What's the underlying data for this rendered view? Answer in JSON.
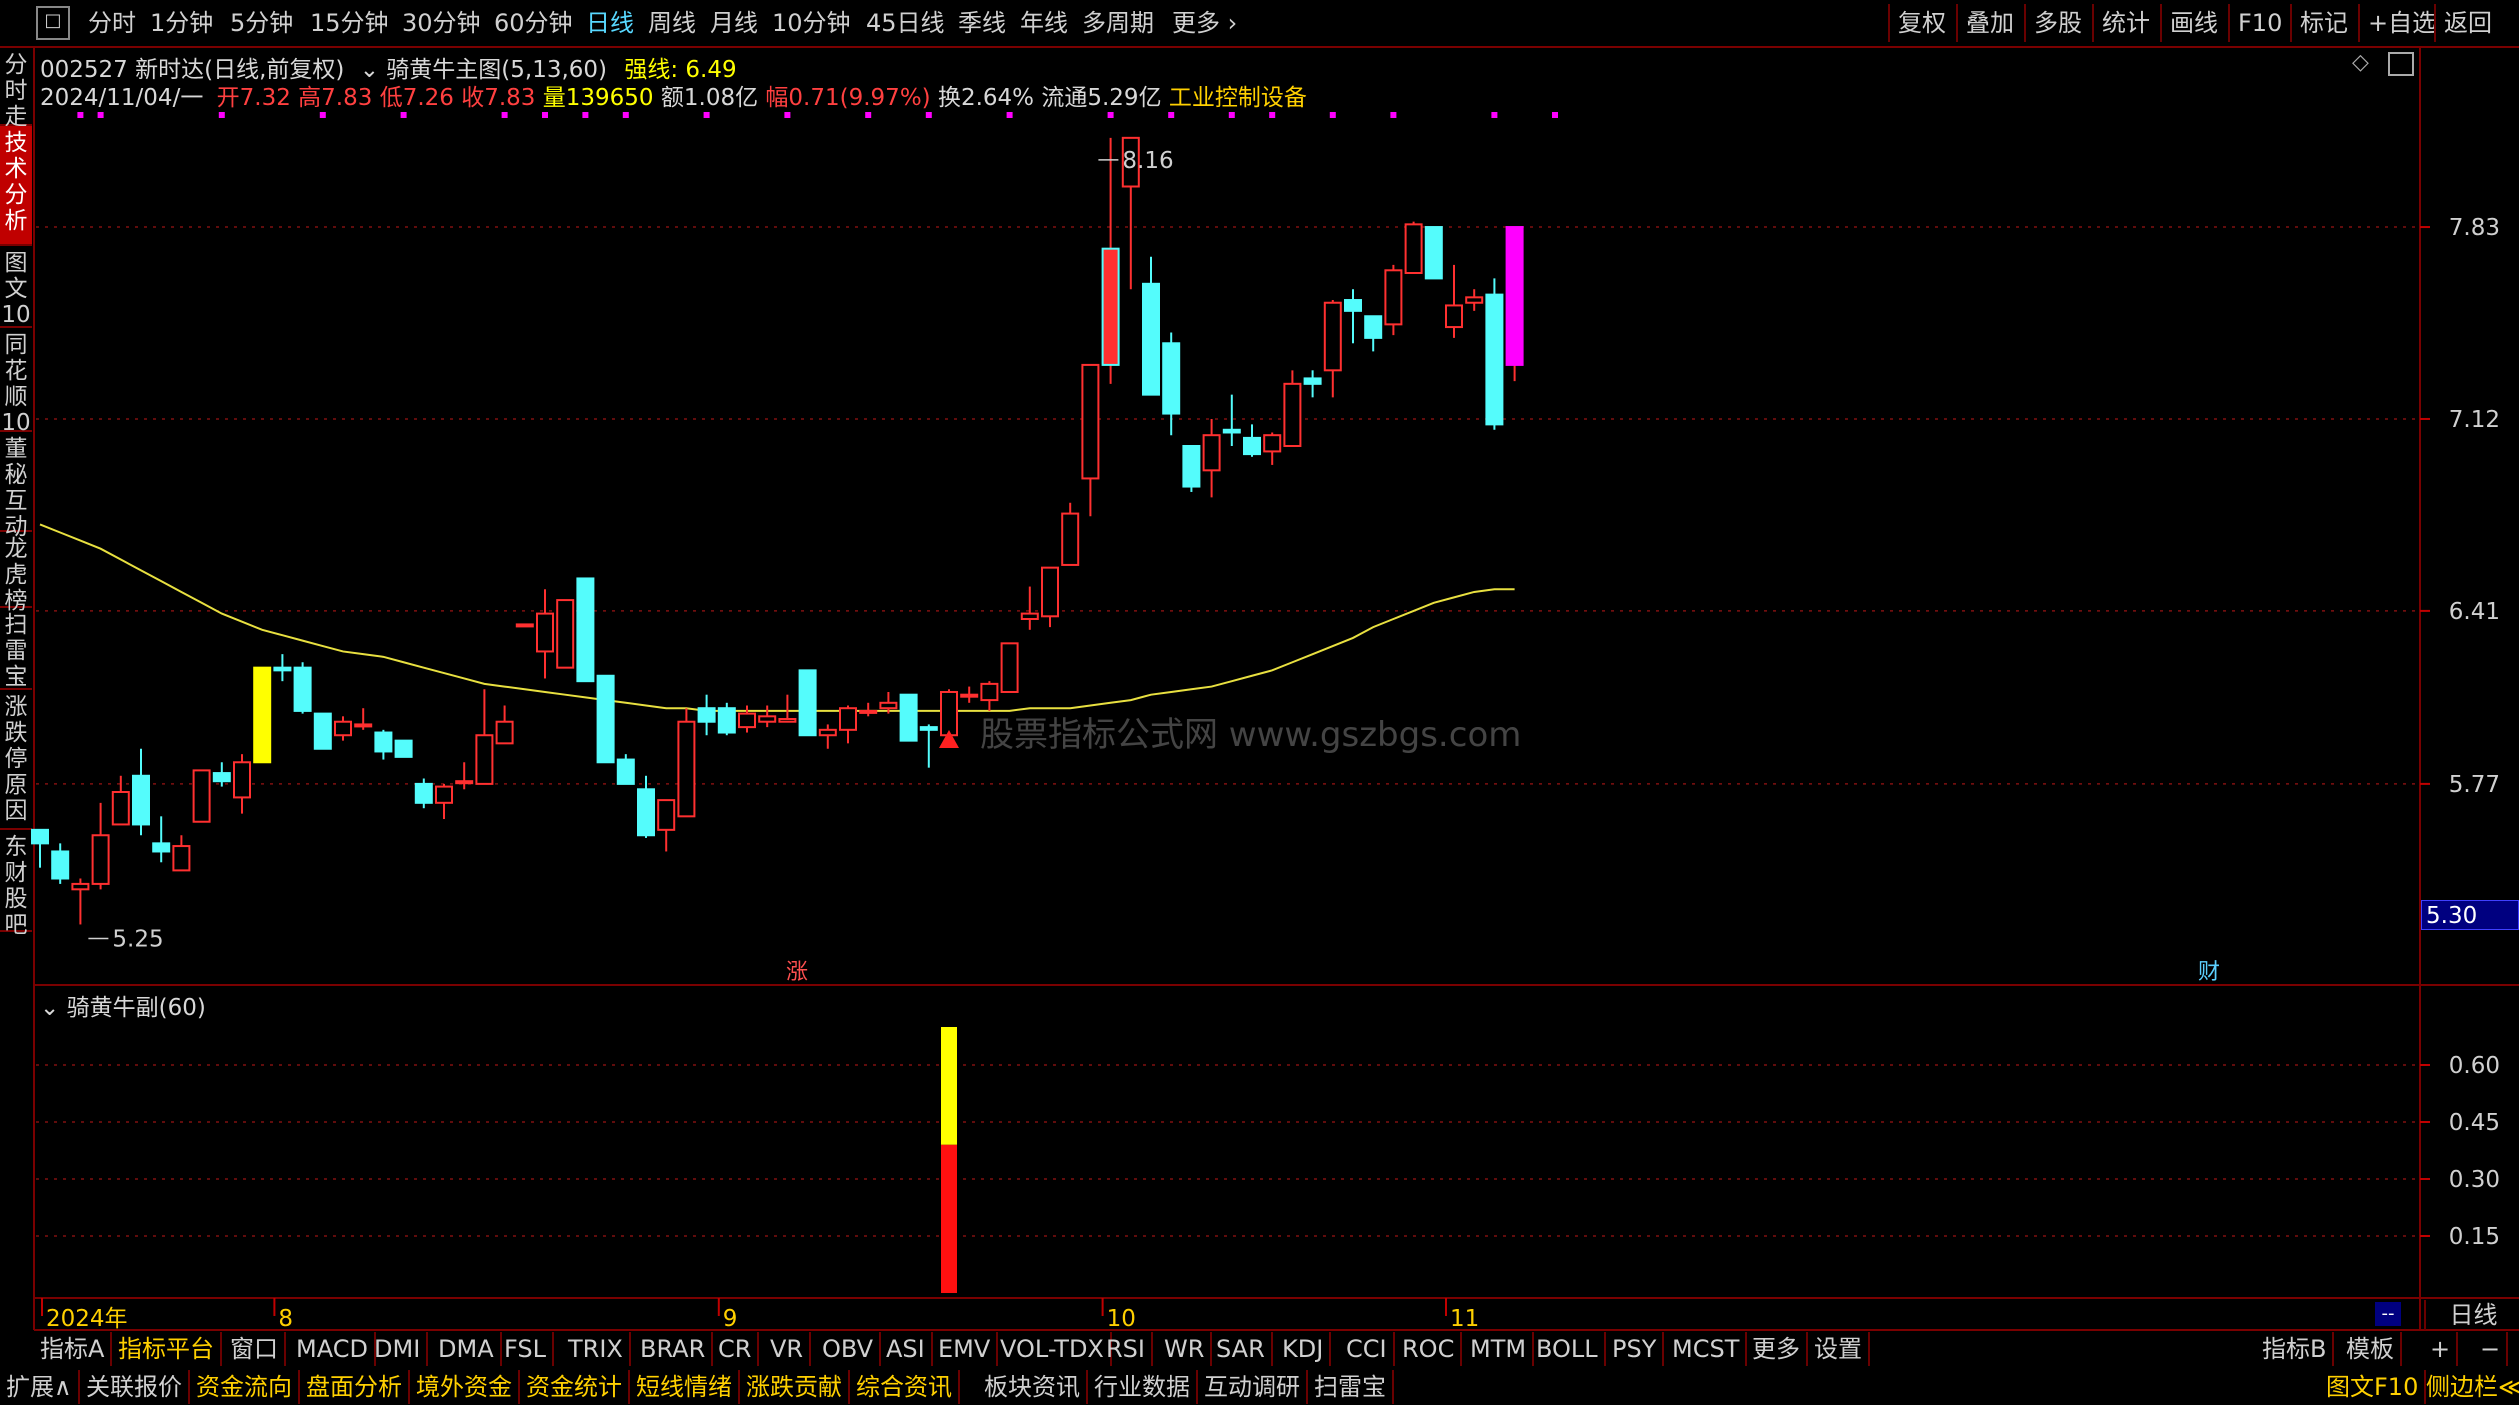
{
  "toolbar": {
    "periods": [
      "分时",
      "1分钟",
      "5分钟",
      "15分钟",
      "30分钟",
      "60分钟",
      "日线",
      "周线",
      "月线",
      "10分钟",
      "45日线",
      "季线",
      "年线",
      "多周期",
      "更多"
    ],
    "active_period": "日线",
    "right_buttons": [
      "复权",
      "叠加",
      "多股",
      "统计",
      "画线",
      "F10",
      "标记",
      "+自选",
      "返回"
    ]
  },
  "left_tabs": [
    "分时走势",
    "技术分析",
    "图文10",
    "同花顺10",
    "董秘互动",
    "龙虎榜",
    "扫雷宝",
    "涨跌停原因",
    "东财股吧"
  ],
  "header": {
    "stock": "002527 新时达(日线,前复权)",
    "indicator": "骑黄牛主图(5,13,60)",
    "strong_label": "强线:",
    "strong_value": "6.49",
    "date": "2024/11/04/一",
    "open_label": "开",
    "open": "7.32",
    "high_label": "高",
    "high": "7.83",
    "low_label": "低",
    "low": "7.26",
    "close_label": "收",
    "close": "7.83",
    "vol_label": "量",
    "vol": "139650",
    "amount": "额1.08亿",
    "change_label": "幅",
    "change": "0.71(9.97%)",
    "turnover": "换2.64%",
    "float": "流通5.29亿",
    "industry": "工业控制设备"
  },
  "sub_header": {
    "indicator": "骑黄牛副(60)"
  },
  "watermark": "股票指标公式网 www.gszbgs.com",
  "markers": {
    "zhang": "涨",
    "cai": "财",
    "current_price": "5.30"
  },
  "bottom_right": {
    "period": "日线",
    "dash": "--"
  },
  "chart_data": [
    {
      "type": "candlestick",
      "y_ticks": [
        5.77,
        6.41,
        7.12,
        7.83
      ],
      "ylim": [
        5.1,
        8.3
      ],
      "x_labels": [
        "2024年",
        "8",
        "9",
        "10",
        "11"
      ],
      "x_label_index": [
        0,
        12,
        34,
        53,
        70
      ],
      "annotations": [
        {
          "text": "8.16",
          "index": 52,
          "value": 8.16
        },
        {
          "text": "5.25",
          "index": 2,
          "value": 5.25
        }
      ],
      "candles": [
        {
          "o": 5.6,
          "h": 5.6,
          "l": 5.46,
          "c": 5.55
        },
        {
          "o": 5.52,
          "h": 5.55,
          "l": 5.4,
          "c": 5.42
        },
        {
          "o": 5.38,
          "h": 5.42,
          "l": 5.25,
          "c": 5.4
        },
        {
          "o": 5.4,
          "h": 5.7,
          "l": 5.38,
          "c": 5.58
        },
        {
          "o": 5.62,
          "h": 5.8,
          "l": 5.62,
          "c": 5.74
        },
        {
          "o": 5.8,
          "h": 5.9,
          "l": 5.58,
          "c": 5.62
        },
        {
          "o": 5.55,
          "h": 5.65,
          "l": 5.48,
          "c": 5.52
        },
        {
          "o": 5.45,
          "h": 5.58,
          "l": 5.45,
          "c": 5.54
        },
        {
          "o": 5.63,
          "h": 5.82,
          "l": 5.63,
          "c": 5.82
        },
        {
          "o": 5.81,
          "h": 5.85,
          "l": 5.76,
          "c": 5.78
        },
        {
          "o": 5.72,
          "h": 5.88,
          "l": 5.66,
          "c": 5.85
        },
        {
          "o": 5.85,
          "h": 6.2,
          "l": 5.85,
          "c": 6.2
        },
        {
          "o": 6.2,
          "h": 6.25,
          "l": 6.15,
          "c": 6.19
        },
        {
          "o": 6.2,
          "h": 6.22,
          "l": 6.03,
          "c": 6.04
        },
        {
          "o": 6.03,
          "h": 6.03,
          "l": 5.9,
          "c": 5.9
        },
        {
          "o": 5.95,
          "h": 6.02,
          "l": 5.93,
          "c": 6.0
        },
        {
          "o": 5.99,
          "h": 6.05,
          "l": 5.97,
          "c": 5.99
        },
        {
          "o": 5.96,
          "h": 5.97,
          "l": 5.86,
          "c": 5.89
        },
        {
          "o": 5.93,
          "h": 5.93,
          "l": 5.87,
          "c": 5.87
        },
        {
          "o": 5.77,
          "h": 5.79,
          "l": 5.68,
          "c": 5.7
        },
        {
          "o": 5.7,
          "h": 5.77,
          "l": 5.64,
          "c": 5.76
        },
        {
          "o": 5.78,
          "h": 5.85,
          "l": 5.75,
          "c": 5.78
        },
        {
          "o": 5.77,
          "h": 6.12,
          "l": 5.77,
          "c": 5.95
        },
        {
          "o": 5.92,
          "h": 6.06,
          "l": 5.92,
          "c": 6.0
        },
        {
          "o": 6.36,
          "h": 6.36,
          "l": 6.36,
          "c": 6.36
        },
        {
          "o": 6.26,
          "h": 6.49,
          "l": 6.16,
          "c": 6.4
        },
        {
          "o": 6.2,
          "h": 6.45,
          "l": 6.2,
          "c": 6.45
        },
        {
          "o": 6.53,
          "h": 6.53,
          "l": 6.15,
          "c": 6.15
        },
        {
          "o": 6.17,
          "h": 6.17,
          "l": 5.85,
          "c": 5.85
        },
        {
          "o": 5.86,
          "h": 5.88,
          "l": 5.77,
          "c": 5.77
        },
        {
          "o": 5.75,
          "h": 5.8,
          "l": 5.57,
          "c": 5.58
        },
        {
          "o": 5.6,
          "h": 5.71,
          "l": 5.52,
          "c": 5.71
        },
        {
          "o": 5.65,
          "h": 6.05,
          "l": 5.65,
          "c": 6.0
        },
        {
          "o": 6.05,
          "h": 6.1,
          "l": 5.95,
          "c": 6.0
        },
        {
          "o": 6.05,
          "h": 6.07,
          "l": 5.95,
          "c": 5.96
        },
        {
          "o": 5.98,
          "h": 6.06,
          "l": 5.96,
          "c": 6.03
        },
        {
          "o": 6.0,
          "h": 6.06,
          "l": 5.98,
          "c": 6.02
        },
        {
          "o": 6.0,
          "h": 6.1,
          "l": 6.0,
          "c": 6.01
        },
        {
          "o": 6.19,
          "h": 6.19,
          "l": 5.95,
          "c": 5.95
        },
        {
          "o": 5.95,
          "h": 5.99,
          "l": 5.9,
          "c": 5.97
        },
        {
          "o": 5.97,
          "h": 6.06,
          "l": 5.92,
          "c": 6.05
        },
        {
          "o": 6.04,
          "h": 6.07,
          "l": 6.02,
          "c": 6.04
        },
        {
          "o": 6.05,
          "h": 6.11,
          "l": 6.03,
          "c": 6.07
        },
        {
          "o": 6.1,
          "h": 6.1,
          "l": 5.93,
          "c": 5.93
        },
        {
          "o": 5.98,
          "h": 5.99,
          "l": 5.83,
          "c": 5.97
        },
        {
          "o": 5.95,
          "h": 6.12,
          "l": 5.95,
          "c": 6.11
        },
        {
          "o": 6.1,
          "h": 6.13,
          "l": 6.07,
          "c": 6.1
        },
        {
          "o": 6.08,
          "h": 6.15,
          "l": 6.04,
          "c": 6.14
        },
        {
          "o": 6.11,
          "h": 6.29,
          "l": 6.11,
          "c": 6.29
        },
        {
          "o": 6.38,
          "h": 6.5,
          "l": 6.34,
          "c": 6.4
        },
        {
          "o": 6.39,
          "h": 6.57,
          "l": 6.35,
          "c": 6.57
        },
        {
          "o": 6.58,
          "h": 6.81,
          "l": 6.58,
          "c": 6.77
        },
        {
          "o": 6.9,
          "h": 7.28,
          "l": 6.76,
          "c": 7.32
        },
        {
          "o": 7.32,
          "h": 8.16,
          "l": 7.25,
          "c": 7.75
        },
        {
          "o": 7.98,
          "h": 8.16,
          "l": 7.6,
          "c": 8.16
        },
        {
          "o": 7.62,
          "h": 7.72,
          "l": 7.21,
          "c": 7.21
        },
        {
          "o": 7.4,
          "h": 7.44,
          "l": 7.06,
          "c": 7.14
        },
        {
          "o": 7.02,
          "h": 7.02,
          "l": 6.85,
          "c": 6.87
        },
        {
          "o": 6.93,
          "h": 7.12,
          "l": 6.83,
          "c": 7.06
        },
        {
          "o": 7.08,
          "h": 7.21,
          "l": 7.02,
          "c": 7.07
        },
        {
          "o": 7.05,
          "h": 7.1,
          "l": 6.98,
          "c": 6.99
        },
        {
          "o": 7.0,
          "h": 7.07,
          "l": 6.95,
          "c": 7.06
        },
        {
          "o": 7.02,
          "h": 7.3,
          "l": 7.02,
          "c": 7.25
        },
        {
          "o": 7.27,
          "h": 7.3,
          "l": 7.2,
          "c": 7.25
        },
        {
          "o": 7.3,
          "h": 7.56,
          "l": 7.2,
          "c": 7.55
        },
        {
          "o": 7.56,
          "h": 7.6,
          "l": 7.4,
          "c": 7.52
        },
        {
          "o": 7.5,
          "h": 7.49,
          "l": 7.37,
          "c": 7.42
        },
        {
          "o": 7.47,
          "h": 7.69,
          "l": 7.43,
          "c": 7.67
        },
        {
          "o": 7.66,
          "h": 7.85,
          "l": 7.66,
          "c": 7.84
        },
        {
          "o": 7.83,
          "h": 7.83,
          "l": 7.72,
          "c": 7.64
        },
        {
          "o": 7.46,
          "h": 7.69,
          "l": 7.42,
          "c": 7.54
        },
        {
          "o": 7.55,
          "h": 7.6,
          "l": 7.52,
          "c": 7.57
        },
        {
          "o": 7.58,
          "h": 7.64,
          "l": 7.08,
          "c": 7.1
        },
        {
          "o": 7.32,
          "h": 7.83,
          "l": 7.26,
          "c": 7.83
        }
      ],
      "ma60": [
        6.73,
        6.7,
        6.67,
        6.64,
        6.6,
        6.56,
        6.52,
        6.48,
        6.44,
        6.4,
        6.37,
        6.34,
        6.32,
        6.3,
        6.28,
        6.26,
        6.25,
        6.24,
        6.22,
        6.2,
        6.18,
        6.16,
        6.14,
        6.13,
        6.12,
        6.11,
        6.1,
        6.09,
        6.08,
        6.07,
        6.06,
        6.05,
        6.05,
        6.04,
        6.04,
        6.04,
        6.04,
        6.04,
        6.04,
        6.04,
        6.04,
        6.04,
        6.04,
        6.04,
        6.04,
        6.04,
        6.04,
        6.04,
        6.04,
        6.05,
        6.05,
        6.05,
        6.06,
        6.07,
        6.08,
        6.1,
        6.11,
        6.12,
        6.13,
        6.15,
        6.17,
        6.19,
        6.22,
        6.25,
        6.28,
        6.31,
        6.35,
        6.38,
        6.41,
        6.44,
        6.46,
        6.48,
        6.49,
        6.49
      ],
      "ma60_start": 0,
      "signal_triangle": {
        "index": 45,
        "value": 5.94
      },
      "top_dot_indices": [
        2,
        3,
        9,
        14,
        18,
        23,
        25,
        27,
        29,
        33,
        37,
        41,
        44,
        48,
        53,
        56,
        59,
        61,
        64,
        67,
        72,
        75
      ]
    },
    {
      "type": "bar",
      "y_ticks": [
        0.15,
        0.3,
        0.45,
        0.6
      ],
      "ylim": [
        0,
        0.7
      ],
      "bar": {
        "index": 45,
        "total": 0.7,
        "red_part": 0.39
      }
    }
  ],
  "indicator_tabs": [
    "指标A",
    "指标平台",
    "窗口",
    "MACD",
    "DMI",
    "DMA",
    "FSL",
    "TRIX",
    "BRAR",
    "CR",
    "VR",
    "OBV",
    "ASI",
    "EMV",
    "VOL-TDX",
    "RSI",
    "WR",
    "SAR",
    "KDJ",
    "CCI",
    "ROC",
    "MTM",
    "BOLL",
    "PSY",
    "MCST",
    "更多",
    "设置"
  ],
  "indicator_right": [
    "指标B",
    "模板",
    "+",
    "−"
  ],
  "bottom_tabs": [
    "扩展∧",
    "关联报价",
    "资金流向",
    "盘面分析",
    "境外资金",
    "资金统计",
    "短线情绪",
    "涨跌贡献",
    "综合资讯",
    "板块资讯",
    "行业数据",
    "互动调研",
    "扫雷宝"
  ],
  "bottom_right_tabs": [
    "图文F10",
    "侧边栏≪"
  ],
  "colors": {
    "up": "#ff3030",
    "down": "#54fcfc",
    "ma": "#e8e040",
    "grid": "#801010",
    "magenta": "#ff00ff",
    "yellow": "#ffff00",
    "active": "#58d8ff"
  }
}
